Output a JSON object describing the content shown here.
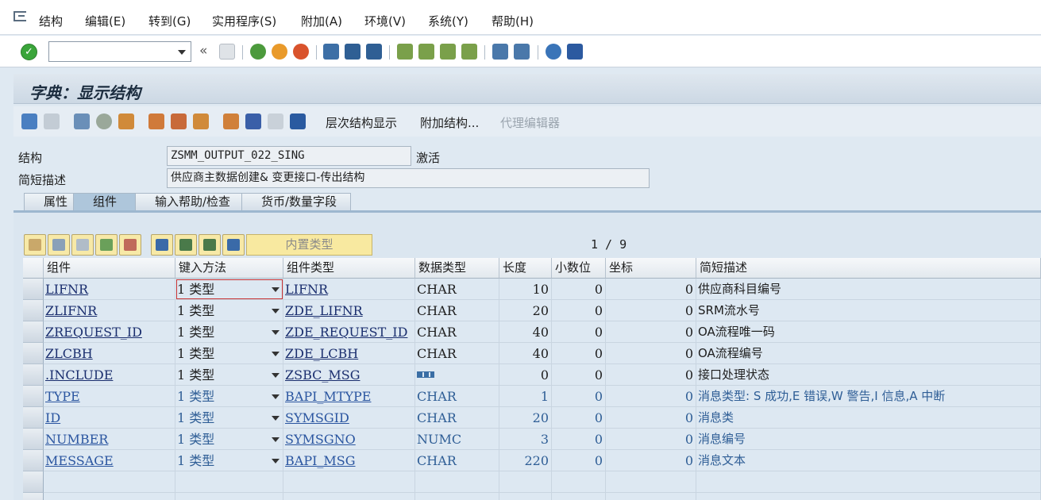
{
  "menu": [
    "结构",
    "编辑(E)",
    "转到(G)",
    "实用程序(S)",
    "附加(A)",
    "环境(V)",
    "系统(Y)",
    "帮助(H)"
  ],
  "toolbar": {
    "command_value": "",
    "back_symbol": "«"
  },
  "title": "字典：显示结构",
  "app_toolbar": {
    "hierarchy_label": "层次结构显示",
    "append_label": "附加结构...",
    "proxy_label": "代理编辑器"
  },
  "header": {
    "struct_label": "结构",
    "struct_value": "ZSMM_OUTPUT_022_SING",
    "status": "激活",
    "desc_label": "简短描述",
    "desc_value": "供应商主数据创建& 变更接口-传出结构"
  },
  "tabs": [
    "属性",
    "组件",
    "输入帮助/检查",
    "货币/数量字段"
  ],
  "active_tab": 1,
  "grid_toolbar": {
    "builtin_label": "内置类型",
    "page": "1 / 9"
  },
  "columns": [
    "组件",
    "键入方法",
    "组件类型",
    "数据类型",
    "长度",
    "小数位",
    "坐标",
    "简短描述"
  ],
  "rows": [
    {
      "component": "LIFNR",
      "method": "1 类型",
      "comp_type": "LIFNR",
      "data_type": "CHAR",
      "length": "10",
      "decimals": "0",
      "coord": "0",
      "desc": "供应商科目编号",
      "dim": false
    },
    {
      "component": "ZLIFNR",
      "method": "1 类型",
      "comp_type": "ZDE_LIFNR",
      "data_type": "CHAR",
      "length": "20",
      "decimals": "0",
      "coord": "0",
      "desc": "SRM流水号",
      "dim": false
    },
    {
      "component": "ZREQUEST_ID",
      "method": "1 类型",
      "comp_type": "ZDE_REQUEST_ID",
      "data_type": "CHAR",
      "length": "40",
      "decimals": "0",
      "coord": "0",
      "desc": "OA流程唯一码",
      "dim": false
    },
    {
      "component": "ZLCBH",
      "method": "1 类型",
      "comp_type": "ZDE_LCBH",
      "data_type": "CHAR",
      "length": "40",
      "decimals": "0",
      "coord": "0",
      "desc": "OA流程编号",
      "dim": false
    },
    {
      "component": ".INCLUDE",
      "method": "1 类型",
      "comp_type": "ZSBC_MSG",
      "data_type": "",
      "length": "0",
      "decimals": "0",
      "coord": "0",
      "desc": "接口处理状态",
      "dim": false,
      "struct_icon": true
    },
    {
      "component": "TYPE",
      "method": "1 类型",
      "comp_type": "BAPI_MTYPE",
      "data_type": "CHAR",
      "length": "1",
      "decimals": "0",
      "coord": "0",
      "desc": "消息类型: S 成功,E 错误,W 警告,I 信息,A 中断",
      "dim": true
    },
    {
      "component": "ID",
      "method": "1 类型",
      "comp_type": "SYMSGID",
      "data_type": "CHAR",
      "length": "20",
      "decimals": "0",
      "coord": "0",
      "desc": "消息类",
      "dim": true
    },
    {
      "component": "NUMBER",
      "method": "1 类型",
      "comp_type": "SYMSGNO",
      "data_type": "NUMC",
      "length": "3",
      "decimals": "0",
      "coord": "0",
      "desc": "消息编号",
      "dim": true
    },
    {
      "component": "MESSAGE",
      "method": "1 类型",
      "comp_type": "BAPI_MSG",
      "data_type": "CHAR",
      "length": "220",
      "decimals": "0",
      "coord": "0",
      "desc": "消息文本",
      "dim": true
    }
  ]
}
